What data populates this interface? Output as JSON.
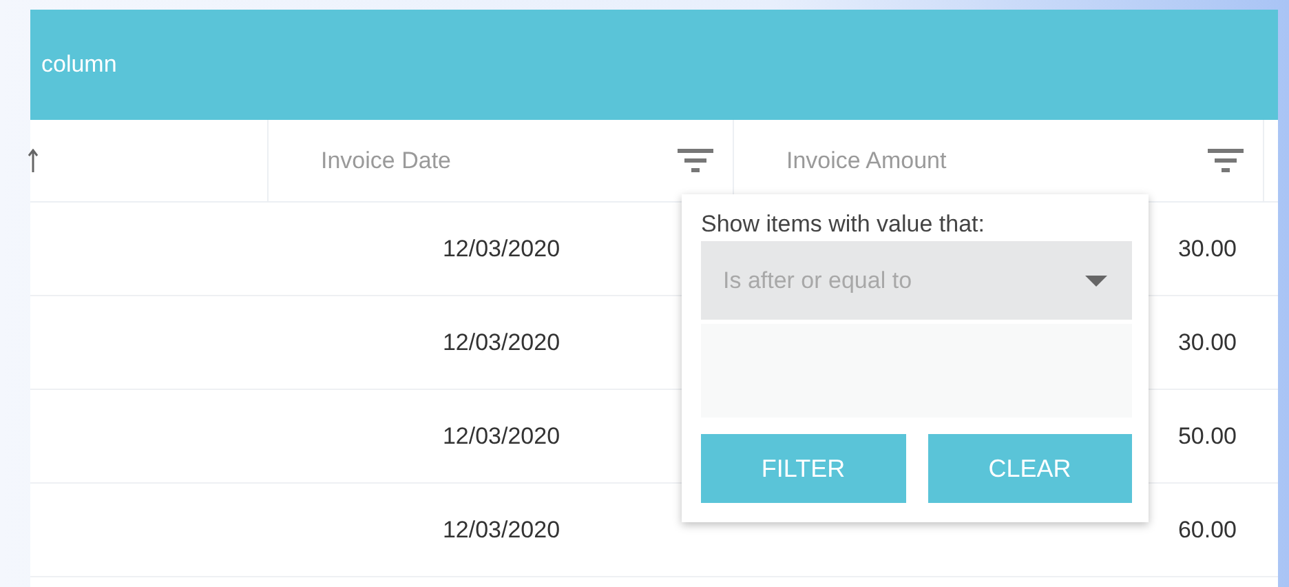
{
  "group_panel": {
    "text": "column"
  },
  "columns": [
    {
      "kind": "sorted"
    },
    {
      "kind": "filter",
      "label": "Invoice Date"
    },
    {
      "kind": "filter",
      "label": "Invoice Amount"
    }
  ],
  "rows": [
    {
      "invoice_date": "12/03/2020",
      "invoice_amount": "30.00"
    },
    {
      "invoice_date": "12/03/2020",
      "invoice_amount": "30.00"
    },
    {
      "invoice_date": "12/03/2020",
      "invoice_amount": "50.00"
    },
    {
      "invoice_date": "12/03/2020",
      "invoice_amount": "60.00"
    }
  ],
  "filter_menu": {
    "prompt": "Show items with value that:",
    "operator": "Is after or equal to",
    "buttons": [
      "FILTER",
      "CLEAR"
    ]
  }
}
